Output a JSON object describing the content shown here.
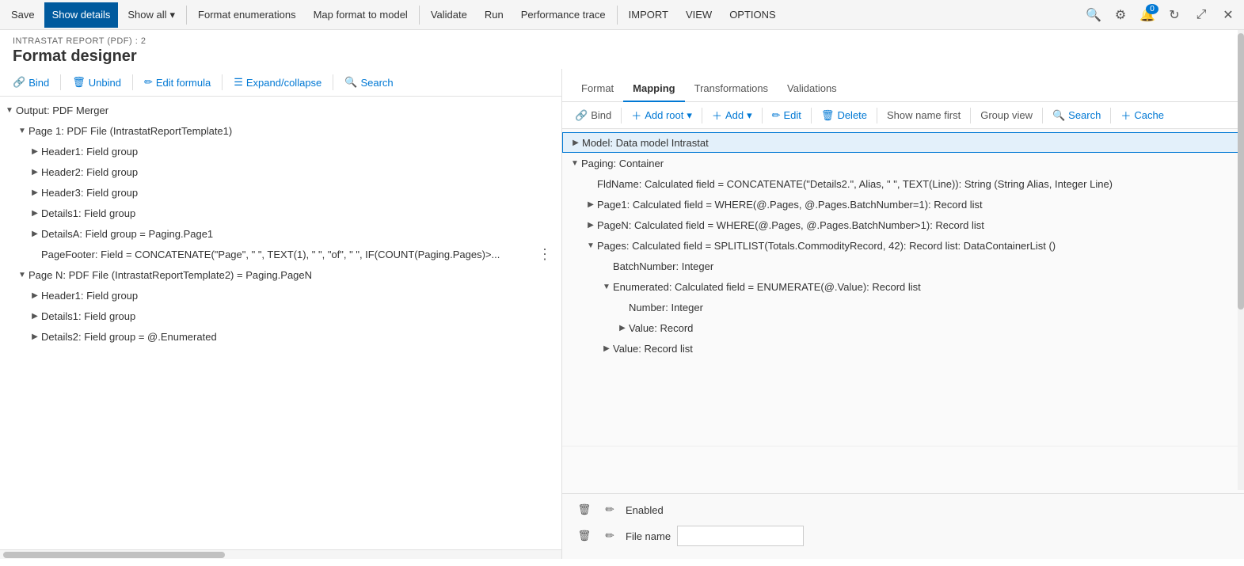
{
  "toolbar": {
    "save_label": "Save",
    "show_details_label": "Show details",
    "show_all_label": "Show all",
    "format_enumerations_label": "Format enumerations",
    "map_format_to_model_label": "Map format to model",
    "validate_label": "Validate",
    "run_label": "Run",
    "performance_trace_label": "Performance trace",
    "import_label": "IMPORT",
    "view_label": "VIEW",
    "options_label": "OPTIONS",
    "badge_count": "0"
  },
  "page": {
    "breadcrumb": "INTRASTAT REPORT (PDF) : 2",
    "title": "Format designer"
  },
  "left_toolbar": {
    "bind_label": "Bind",
    "unbind_label": "Unbind",
    "edit_formula_label": "Edit formula",
    "expand_collapse_label": "Expand/collapse",
    "search_label": "Search"
  },
  "left_tree": {
    "items": [
      {
        "level": 0,
        "expanded": true,
        "label": "Output: PDF Merger"
      },
      {
        "level": 1,
        "expanded": true,
        "label": "Page 1: PDF File (IntrastatReportTemplate1)"
      },
      {
        "level": 2,
        "expanded": false,
        "label": "Header1: Field group"
      },
      {
        "level": 2,
        "expanded": false,
        "label": "Header2: Field group"
      },
      {
        "level": 2,
        "expanded": false,
        "label": "Header3: Field group"
      },
      {
        "level": 2,
        "expanded": false,
        "label": "Details1: Field group"
      },
      {
        "level": 2,
        "expanded": false,
        "label": "DetailsA: Field group = Paging.Page1"
      },
      {
        "level": 2,
        "expanded": false,
        "label": "PageFooter: Field = CONCATENATE(\"Page\", \" \", TEXT(1), \" \", \"of\", \" \", IF(COUNT(Paging.Pages)>..."
      },
      {
        "level": 1,
        "expanded": true,
        "label": "Page N: PDF File (IntrastatReportTemplate2) = Paging.PageN"
      },
      {
        "level": 2,
        "expanded": false,
        "label": "Header1: Field group"
      },
      {
        "level": 2,
        "expanded": false,
        "label": "Details1: Field group"
      },
      {
        "level": 2,
        "expanded": false,
        "label": "Details2: Field group = @.Enumerated"
      }
    ]
  },
  "right_tabs": {
    "format_label": "Format",
    "mapping_label": "Mapping",
    "transformations_label": "Transformations",
    "validations_label": "Validations"
  },
  "right_toolbar": {
    "bind_label": "Bind",
    "add_root_label": "Add root",
    "add_label": "Add",
    "edit_label": "Edit",
    "delete_label": "Delete",
    "show_name_first_label": "Show name first",
    "group_view_label": "Group view",
    "search_label": "Search",
    "cache_label": "Cache"
  },
  "model_tree": {
    "items": [
      {
        "level": 0,
        "expanded": false,
        "label": "Model: Data model Intrastat",
        "selected": true
      },
      {
        "level": 0,
        "expanded": true,
        "label": "Paging: Container"
      },
      {
        "level": 1,
        "expanded": false,
        "label": "FldName: Calculated field = CONCATENATE(\"Details2.\", Alias, \" \", TEXT(Line)): String (String Alias, Integer Line)"
      },
      {
        "level": 1,
        "expanded": false,
        "label": "Page1: Calculated field = WHERE(@.Pages, @.Pages.BatchNumber=1): Record list"
      },
      {
        "level": 1,
        "expanded": false,
        "label": "PageN: Calculated field = WHERE(@.Pages, @.Pages.BatchNumber>1): Record list"
      },
      {
        "level": 1,
        "expanded": true,
        "label": "Pages: Calculated field = SPLITLIST(Totals.CommodityRecord, 42): Record list: DataContainerList ()"
      },
      {
        "level": 2,
        "expanded": false,
        "label": "BatchNumber: Integer"
      },
      {
        "level": 2,
        "expanded": true,
        "label": "Enumerated: Calculated field = ENUMERATE(@.Value): Record list"
      },
      {
        "level": 3,
        "expanded": false,
        "label": "Number: Integer"
      },
      {
        "level": 3,
        "expanded": false,
        "label": "Value: Record"
      },
      {
        "level": 2,
        "expanded": false,
        "label": "Value: Record list"
      }
    ]
  },
  "bottom_fields": [
    {
      "label": "Enabled",
      "value": ""
    },
    {
      "label": "File name",
      "value": ""
    }
  ]
}
